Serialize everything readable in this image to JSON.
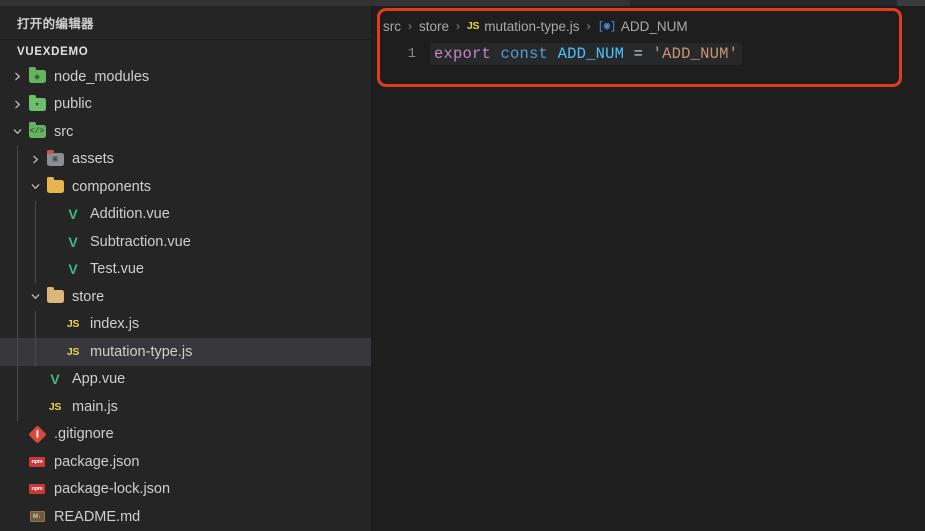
{
  "sidebar": {
    "open_editors_label": "打开的编辑器",
    "project_name": "VUEXDEMO",
    "tree": [
      {
        "label": "node_modules",
        "icon": "folder-green-node",
        "twisty": "collapsed",
        "indent": 0,
        "selected": false
      },
      {
        "label": "public",
        "icon": "folder-green-public",
        "twisty": "collapsed",
        "indent": 0,
        "selected": false
      },
      {
        "label": "src",
        "icon": "folder-green-src",
        "twisty": "expanded",
        "indent": 0,
        "selected": false
      },
      {
        "label": "assets",
        "icon": "folder-assets",
        "twisty": "collapsed",
        "indent": 1,
        "selected": false
      },
      {
        "label": "components",
        "icon": "folder-components",
        "twisty": "expanded",
        "indent": 1,
        "selected": false
      },
      {
        "label": "Addition.vue",
        "icon": "vue-file-icon",
        "twisty": "none",
        "indent": 2,
        "selected": false
      },
      {
        "label": "Subtraction.vue",
        "icon": "vue-file-icon",
        "twisty": "none",
        "indent": 2,
        "selected": false
      },
      {
        "label": "Test.vue",
        "icon": "vue-file-icon",
        "twisty": "none",
        "indent": 2,
        "selected": false
      },
      {
        "label": "store",
        "icon": "folder-store",
        "twisty": "expanded",
        "indent": 1,
        "selected": false
      },
      {
        "label": "index.js",
        "icon": "js-file-icon",
        "twisty": "none",
        "indent": 2,
        "selected": false
      },
      {
        "label": "mutation-type.js",
        "icon": "js-file-icon",
        "twisty": "none",
        "indent": 2,
        "selected": true
      },
      {
        "label": "App.vue",
        "icon": "vue-file-icon",
        "twisty": "none",
        "indent": 1,
        "selected": false
      },
      {
        "label": "main.js",
        "icon": "js-file-icon",
        "twisty": "none",
        "indent": 1,
        "selected": false
      },
      {
        "label": ".gitignore",
        "icon": "git-file-icon",
        "twisty": "none",
        "indent": 0,
        "selected": false
      },
      {
        "label": "package.json",
        "icon": "npm-file-icon",
        "twisty": "none",
        "indent": 0,
        "selected": false
      },
      {
        "label": "package-lock.json",
        "icon": "npm-file-icon",
        "twisty": "none",
        "indent": 0,
        "selected": false
      },
      {
        "label": "README.md",
        "icon": "markdown-file-icon",
        "twisty": "none",
        "indent": 0,
        "selected": false
      }
    ]
  },
  "editor": {
    "breadcrumb": [
      {
        "text": "src",
        "icon": "none"
      },
      {
        "text": "store",
        "icon": "none"
      },
      {
        "text": "mutation-type.js",
        "icon": "js-file-icon"
      },
      {
        "text": "ADD_NUM",
        "icon": "symbol-variable-icon"
      }
    ],
    "breadcrumb_separator": "›",
    "line_number": "1",
    "code_tokens": [
      {
        "text": "export",
        "type": "keyword"
      },
      {
        "text": " ",
        "type": "plain"
      },
      {
        "text": "const",
        "type": "storage"
      },
      {
        "text": " ",
        "type": "plain"
      },
      {
        "text": "ADD_NUM",
        "type": "variable"
      },
      {
        "text": " ",
        "type": "plain"
      },
      {
        "text": "=",
        "type": "operator"
      },
      {
        "text": " ",
        "type": "plain"
      },
      {
        "text": "'ADD_NUM'",
        "type": "string"
      }
    ],
    "highlight_color": "#e33b1f"
  }
}
